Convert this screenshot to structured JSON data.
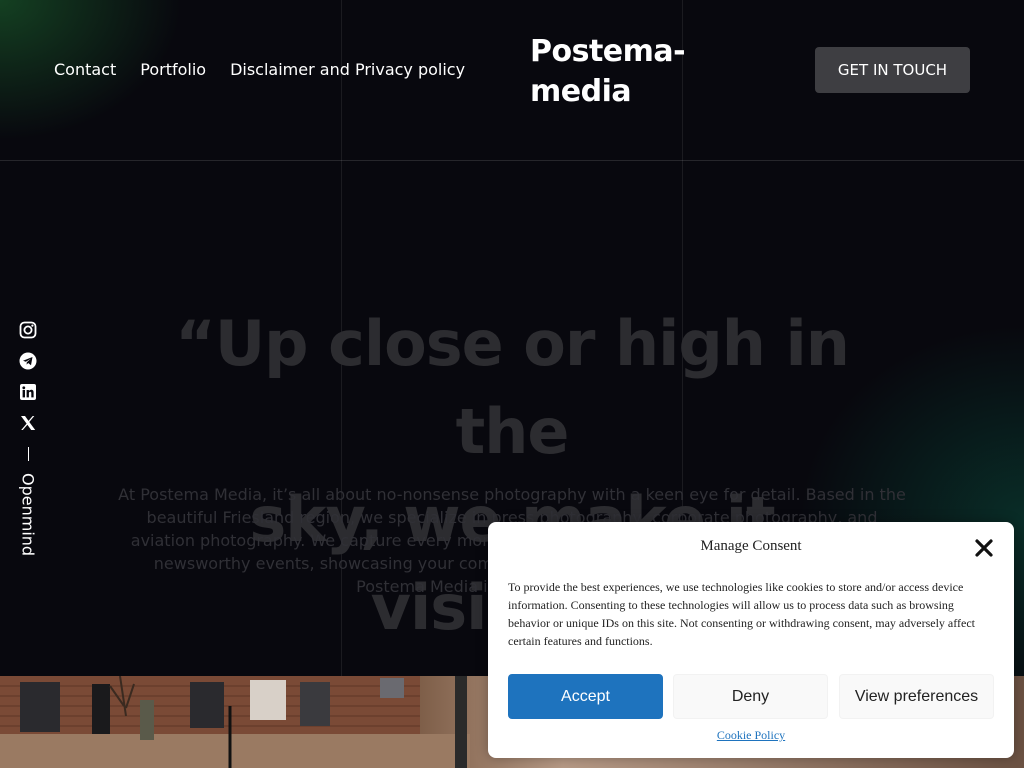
{
  "nav": {
    "items": [
      {
        "label": "Contact"
      },
      {
        "label": "Portfolio"
      },
      {
        "label": "Disclaimer and Privacy policy"
      }
    ]
  },
  "logo": {
    "line1": "Postema-",
    "line2": "media"
  },
  "cta": {
    "label": "GET IN TOUCH",
    "color": "#3e3e42"
  },
  "social": {
    "icons": [
      "instagram-icon",
      "telegram-icon",
      "linkedin-icon",
      "x-icon"
    ],
    "vertical_label": "Openmind"
  },
  "hero": {
    "quote_line1": "“Up close or high in the",
    "quote_line2": "sky, we make it visible.”",
    "text": "At Postema Media, it’s all about no-nonsense photography with a keen eye for detail. Based in the beautiful Friesland region, we specialize in press photography, corporate photography, and aviation photography. We capture every moment, whether it’s a corporate event, documenting newsworthy events, showcasing your company in the best light or documenting aviation, Postema Media is here for you. Choose"
  },
  "consent": {
    "title": "Manage Consent",
    "body": "To provide the best experiences, we use technologies like cookies to store and/or access device information. Consenting to these technologies will allow us to process data such as browsing behavior or unique IDs on this site. Not consenting or withdrawing consent, may adversely affect certain features and functions.",
    "accept_label": "Accept",
    "deny_label": "Deny",
    "preferences_label": "View preferences",
    "cookie_policy_label": "Cookie Policy",
    "accent_color": "#1e73be"
  }
}
